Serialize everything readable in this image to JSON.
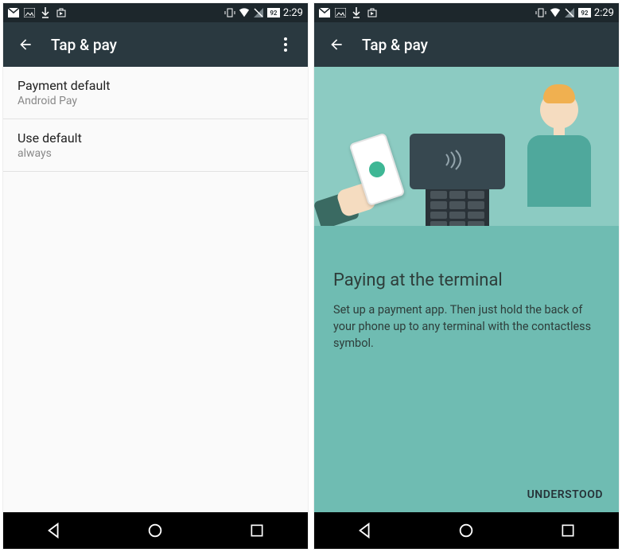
{
  "statusbar": {
    "battery": "92",
    "time": "2:29"
  },
  "screen1": {
    "appbar": {
      "title": "Tap & pay"
    },
    "items": [
      {
        "title": "Payment default",
        "subtitle": "Android Pay"
      },
      {
        "title": "Use default",
        "subtitle": "always"
      }
    ]
  },
  "screen2": {
    "appbar": {
      "title": "Tap & pay"
    },
    "onboard": {
      "heading": "Paying at the terminal",
      "body": "Set up a payment app. Then just hold the back of your phone up to any terminal with the contactless symbol.",
      "action": "UNDERSTOOD"
    }
  }
}
